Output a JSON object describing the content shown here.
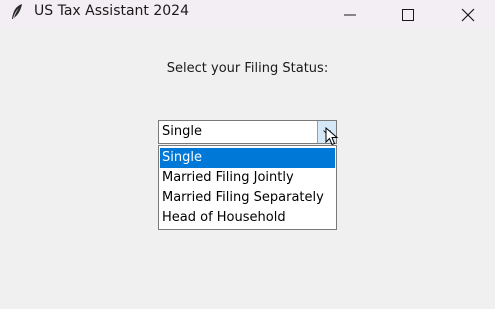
{
  "window": {
    "title": "US Tax Assistant 2024",
    "icon": "feather-icon"
  },
  "main": {
    "prompt_label": "Select your Filing Status:"
  },
  "filing_status": {
    "selected_value": "Single",
    "options": [
      "Single",
      "Married Filing Jointly",
      "Married Filing Separately",
      "Head of Household"
    ],
    "highlighted_index": 0
  },
  "colors": {
    "selection": "#0078d7",
    "dropdown_button": "#d4e8f8"
  }
}
